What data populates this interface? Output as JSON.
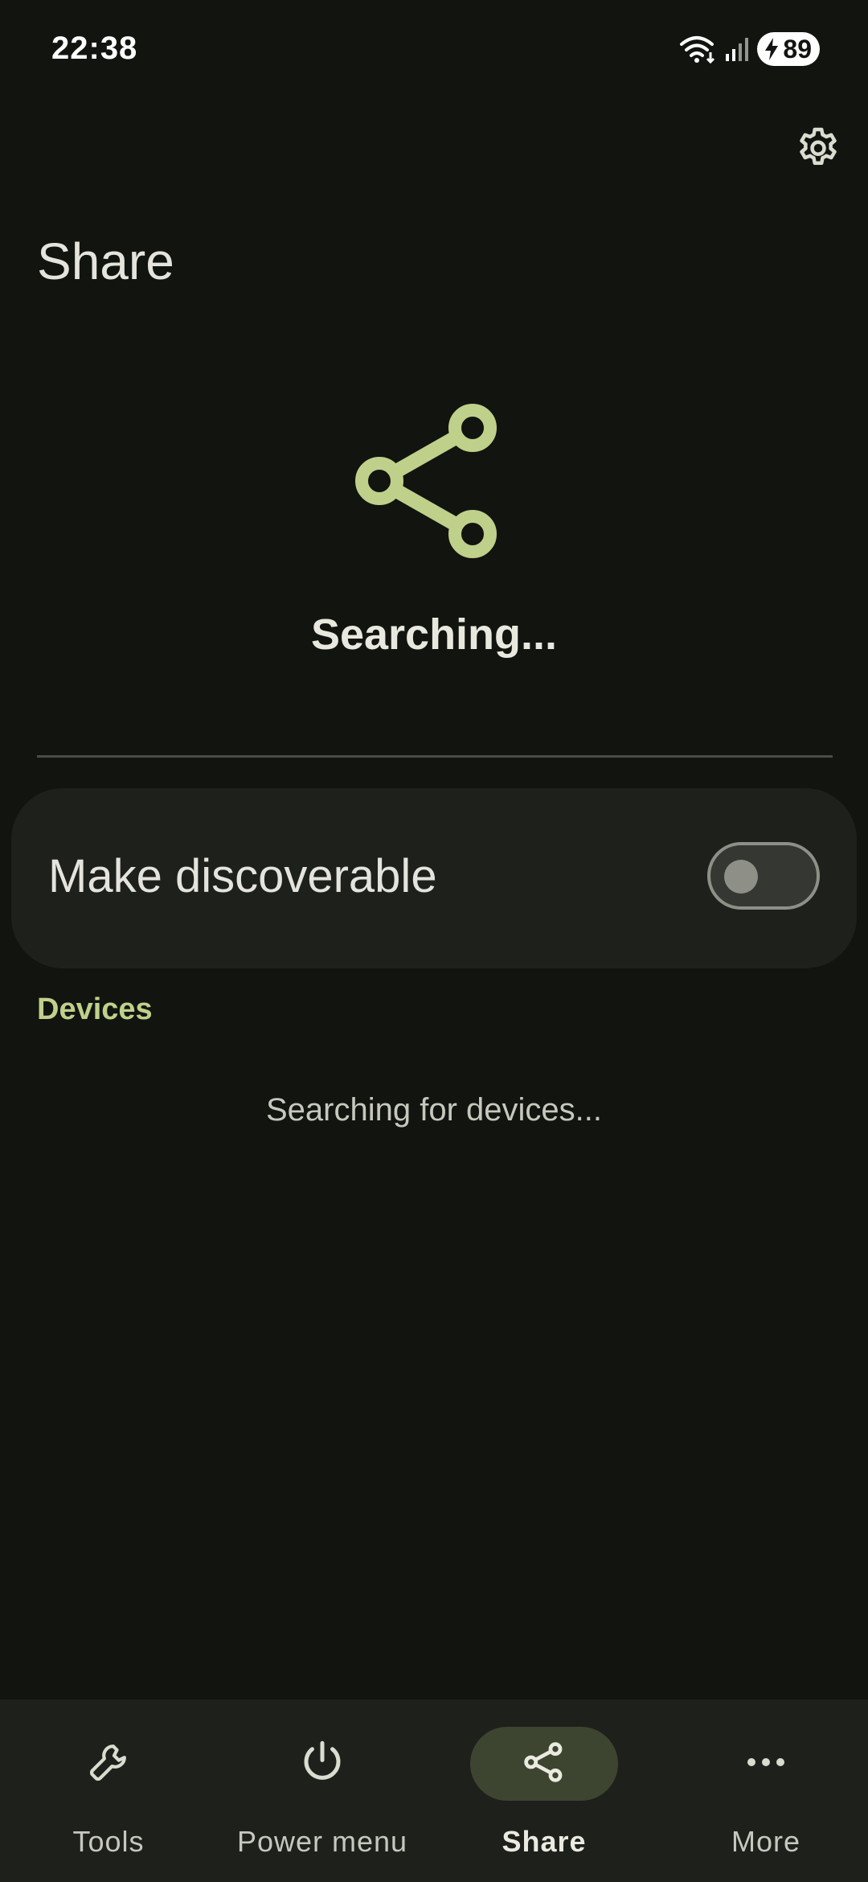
{
  "status_bar": {
    "time": "22:38",
    "battery": "89"
  },
  "header": {
    "title": "Share",
    "settings_icon": "gear-icon"
  },
  "hero": {
    "icon": "share-icon",
    "status": "Searching..."
  },
  "discoverable": {
    "label": "Make discoverable",
    "enabled": false
  },
  "devices": {
    "header": "Devices",
    "empty_text": "Searching for devices..."
  },
  "bottom_nav": {
    "items": [
      {
        "label": "Tools",
        "icon": "wrench-icon",
        "active": false
      },
      {
        "label": "Power menu",
        "icon": "power-icon",
        "active": false
      },
      {
        "label": "Share",
        "icon": "share-icon",
        "active": true
      },
      {
        "label": "More",
        "icon": "more-horizontal-icon",
        "active": false
      }
    ]
  },
  "colors": {
    "background": "#121410",
    "accent": "#bfd08a",
    "card": "#1e201c",
    "nav_active_pill": "#3d4530"
  }
}
